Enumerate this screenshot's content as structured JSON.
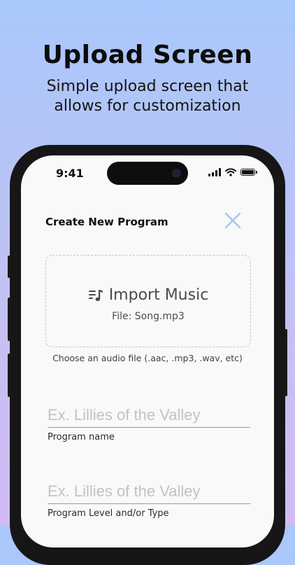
{
  "promo": {
    "headline": "Upload Screen",
    "subline_1": "Simple upload screen that",
    "subline_2": "allows for customization"
  },
  "status_bar": {
    "time": "9:41",
    "icons": [
      "signal-icon",
      "wifi-icon",
      "battery-icon"
    ]
  },
  "header": {
    "title": "Create New Program",
    "close_icon": "close-icon",
    "close_color": "#a9c6f2"
  },
  "import": {
    "icon": "music-list-icon",
    "label": "Import Music",
    "file": "File: Song.mp3",
    "hint": "Choose an audio file (.aac, .mp3, .wav, etc)"
  },
  "fields": [
    {
      "placeholder": "Ex. Lillies of the Valley",
      "value": "",
      "label": "Program name"
    },
    {
      "placeholder": "Ex. Lillies of the Valley",
      "value": "",
      "label": "Program Level and/or Type"
    }
  ],
  "colors": {
    "background_top": "#a9c8fb",
    "background_bottom": "#d0bcf2",
    "accent": "#a9c6f2",
    "phone_frame": "#161616"
  }
}
